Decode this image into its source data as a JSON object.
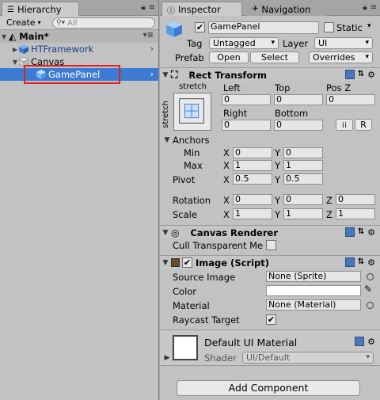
{
  "hierarchy": {
    "tab_label": "Hierarchy",
    "create_label": "Create",
    "search_placeholder": "All",
    "items": [
      {
        "label": "Main*"
      },
      {
        "label": "HTFramework"
      },
      {
        "label": "Canvas"
      },
      {
        "label": "GamePanel"
      }
    ]
  },
  "inspector": {
    "tab_label": "Inspector",
    "nav_tab_label": "Navigation",
    "object_name": "GamePanel",
    "static_label": "Static",
    "tag_label": "Tag",
    "tag_value": "Untagged",
    "layer_label": "Layer",
    "layer_value": "UI",
    "prefab_label": "Prefab",
    "open_label": "Open",
    "select_label": "Select",
    "overrides_label": "Overrides"
  },
  "rect_transform": {
    "title": "Rect Transform",
    "stretch_label": "stretch",
    "left_label": "Left",
    "top_label": "Top",
    "posz_label": "Pos Z",
    "left_value": "0",
    "top_value": "0",
    "posz_value": "0",
    "right_label": "Right",
    "bottom_label": "Bottom",
    "right_value": "0",
    "bottom_value": "0",
    "r_button": "R",
    "anchors_label": "Anchors",
    "min_label": "Min",
    "max_label": "Max",
    "x_label": "X",
    "y_label": "Y",
    "z_label": "Z",
    "min_x": "0",
    "min_y": "0",
    "max_x": "1",
    "max_y": "1",
    "pivot_label": "Pivot",
    "pivot_x": "0.5",
    "pivot_y": "0.5",
    "rotation_label": "Rotation",
    "rot_x": "0",
    "rot_y": "0",
    "rot_z": "0",
    "scale_label": "Scale",
    "scale_x": "1",
    "scale_y": "1",
    "scale_z": "1"
  },
  "canvas_renderer": {
    "title": "Canvas Renderer",
    "cull_label": "Cull Transparent Me"
  },
  "image_script": {
    "title": "Image (Script)",
    "source_label": "Source Image",
    "source_value": "None (Sprite)",
    "color_label": "Color",
    "material_label": "Material",
    "material_value": "None (Material)",
    "raycast_label": "Raycast Target"
  },
  "material_preview": {
    "name": "Default UI Material",
    "shader_label": "Shader",
    "shader_value": "UI/Default"
  },
  "add_component_label": "Add Component",
  "colors": {
    "selection": "#3d7bd3",
    "highlight_box": "#e02020",
    "panel_bg": "#c2c2c2"
  }
}
